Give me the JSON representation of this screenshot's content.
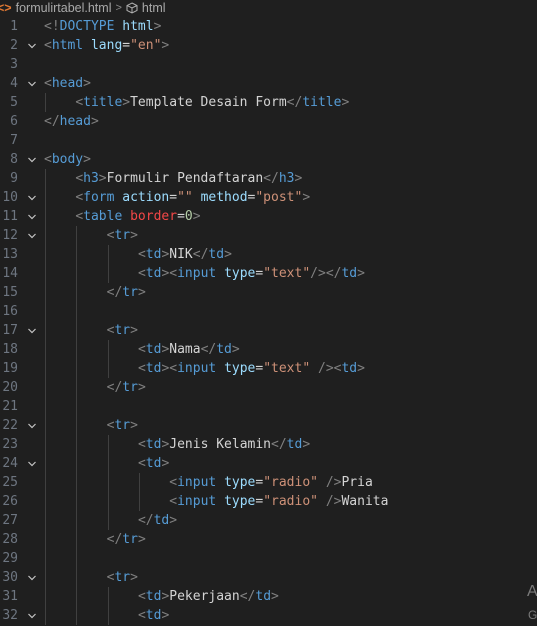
{
  "breadcrumb": {
    "file_icon": "html-file-icon",
    "file": "formulirtabel.html",
    "separator": ">",
    "symbol_icon": "cube-icon",
    "symbol": "html"
  },
  "corner": {
    "a": "A",
    "g": "G"
  },
  "lines": [
    {
      "n": "1",
      "fold": false,
      "indent": 0,
      "tokens": [
        [
          "p",
          "<!"
        ],
        [
          "t",
          "DOCTYPE"
        ],
        [
          "x",
          " "
        ],
        [
          "a",
          "html"
        ],
        [
          "p",
          ">"
        ]
      ]
    },
    {
      "n": "2",
      "fold": true,
      "indent": 0,
      "tokens": [
        [
          "p",
          "<"
        ],
        [
          "t",
          "html"
        ],
        [
          "x",
          " "
        ],
        [
          "a",
          "lang"
        ],
        [
          "e",
          "="
        ],
        [
          "s",
          "\"en\""
        ],
        [
          "p",
          ">"
        ]
      ]
    },
    {
      "n": "3",
      "fold": false,
      "indent": 0,
      "tokens": []
    },
    {
      "n": "4",
      "fold": true,
      "indent": 0,
      "tokens": [
        [
          "p",
          "<"
        ],
        [
          "t",
          "head"
        ],
        [
          "p",
          ">"
        ]
      ]
    },
    {
      "n": "5",
      "fold": false,
      "indent": 1,
      "tokens": [
        [
          "p",
          "<"
        ],
        [
          "t",
          "title"
        ],
        [
          "p",
          ">"
        ],
        [
          "x",
          "Template Desain Form"
        ],
        [
          "p",
          "</"
        ],
        [
          "t",
          "title"
        ],
        [
          "p",
          ">"
        ]
      ]
    },
    {
      "n": "6",
      "fold": false,
      "indent": 0,
      "tokens": [
        [
          "p",
          "</"
        ],
        [
          "t",
          "head"
        ],
        [
          "p",
          ">"
        ]
      ]
    },
    {
      "n": "7",
      "fold": false,
      "indent": 0,
      "tokens": []
    },
    {
      "n": "8",
      "fold": true,
      "indent": 0,
      "tokens": [
        [
          "p",
          "<"
        ],
        [
          "t",
          "body"
        ],
        [
          "p",
          ">"
        ]
      ]
    },
    {
      "n": "9",
      "fold": false,
      "indent": 1,
      "tokens": [
        [
          "p",
          "<"
        ],
        [
          "t",
          "h3"
        ],
        [
          "p",
          ">"
        ],
        [
          "x",
          "Formulir Pendaftaran"
        ],
        [
          "p",
          "</"
        ],
        [
          "t",
          "h3"
        ],
        [
          "p",
          ">"
        ]
      ]
    },
    {
      "n": "10",
      "fold": true,
      "indent": 1,
      "tokens": [
        [
          "p",
          "<"
        ],
        [
          "t",
          "form"
        ],
        [
          "x",
          " "
        ],
        [
          "a",
          "action"
        ],
        [
          "e",
          "="
        ],
        [
          "s",
          "\"\""
        ],
        [
          "x",
          " "
        ],
        [
          "a",
          "method"
        ],
        [
          "e",
          "="
        ],
        [
          "s",
          "\"post\""
        ],
        [
          "p",
          ">"
        ]
      ]
    },
    {
      "n": "11",
      "fold": true,
      "indent": 1,
      "tokens": [
        [
          "p",
          "<"
        ],
        [
          "t",
          "table"
        ],
        [
          "x",
          " "
        ],
        [
          "r",
          "border"
        ],
        [
          "e",
          "="
        ],
        [
          "m",
          "0"
        ],
        [
          "p",
          ">"
        ]
      ]
    },
    {
      "n": "12",
      "fold": true,
      "indent": 2,
      "tokens": [
        [
          "p",
          "<"
        ],
        [
          "t",
          "tr"
        ],
        [
          "p",
          ">"
        ]
      ]
    },
    {
      "n": "13",
      "fold": false,
      "indent": 3,
      "tokens": [
        [
          "p",
          "<"
        ],
        [
          "t",
          "td"
        ],
        [
          "p",
          ">"
        ],
        [
          "x",
          "NIK"
        ],
        [
          "p",
          "</"
        ],
        [
          "t",
          "td"
        ],
        [
          "p",
          ">"
        ]
      ]
    },
    {
      "n": "14",
      "fold": false,
      "indent": 3,
      "tokens": [
        [
          "p",
          "<"
        ],
        [
          "t",
          "td"
        ],
        [
          "p",
          "><"
        ],
        [
          "t",
          "input"
        ],
        [
          "x",
          " "
        ],
        [
          "a",
          "type"
        ],
        [
          "e",
          "="
        ],
        [
          "s",
          "\"text\""
        ],
        [
          "p",
          "/></"
        ],
        [
          "t",
          "td"
        ],
        [
          "p",
          ">"
        ]
      ]
    },
    {
      "n": "15",
      "fold": false,
      "indent": 2,
      "tokens": [
        [
          "p",
          "</"
        ],
        [
          "t",
          "tr"
        ],
        [
          "p",
          ">"
        ]
      ]
    },
    {
      "n": "16",
      "fold": false,
      "indent": 2,
      "tokens": []
    },
    {
      "n": "17",
      "fold": true,
      "indent": 2,
      "tokens": [
        [
          "p",
          "<"
        ],
        [
          "t",
          "tr"
        ],
        [
          "p",
          ">"
        ]
      ]
    },
    {
      "n": "18",
      "fold": false,
      "indent": 3,
      "tokens": [
        [
          "p",
          "<"
        ],
        [
          "t",
          "td"
        ],
        [
          "p",
          ">"
        ],
        [
          "x",
          "Nama"
        ],
        [
          "p",
          "</"
        ],
        [
          "t",
          "td"
        ],
        [
          "p",
          ">"
        ]
      ]
    },
    {
      "n": "19",
      "fold": false,
      "indent": 3,
      "tokens": [
        [
          "p",
          "<"
        ],
        [
          "t",
          "td"
        ],
        [
          "p",
          "><"
        ],
        [
          "t",
          "input"
        ],
        [
          "x",
          " "
        ],
        [
          "a",
          "type"
        ],
        [
          "e",
          "="
        ],
        [
          "s",
          "\"text\""
        ],
        [
          "x",
          " "
        ],
        [
          "p",
          "/><"
        ],
        [
          "t",
          "td"
        ],
        [
          "p",
          ">"
        ]
      ]
    },
    {
      "n": "20",
      "fold": false,
      "indent": 2,
      "tokens": [
        [
          "p",
          "</"
        ],
        [
          "t",
          "tr"
        ],
        [
          "p",
          ">"
        ]
      ]
    },
    {
      "n": "21",
      "fold": false,
      "indent": 2,
      "tokens": []
    },
    {
      "n": "22",
      "fold": true,
      "indent": 2,
      "tokens": [
        [
          "p",
          "<"
        ],
        [
          "t",
          "tr"
        ],
        [
          "p",
          ">"
        ]
      ]
    },
    {
      "n": "23",
      "fold": false,
      "indent": 3,
      "tokens": [
        [
          "p",
          "<"
        ],
        [
          "t",
          "td"
        ],
        [
          "p",
          ">"
        ],
        [
          "x",
          "Jenis Kelamin"
        ],
        [
          "p",
          "</"
        ],
        [
          "t",
          "td"
        ],
        [
          "p",
          ">"
        ]
      ]
    },
    {
      "n": "24",
      "fold": true,
      "indent": 3,
      "tokens": [
        [
          "p",
          "<"
        ],
        [
          "t",
          "td"
        ],
        [
          "p",
          ">"
        ]
      ]
    },
    {
      "n": "25",
      "fold": false,
      "indent": 4,
      "tokens": [
        [
          "p",
          "<"
        ],
        [
          "t",
          "input"
        ],
        [
          "x",
          " "
        ],
        [
          "a",
          "type"
        ],
        [
          "e",
          "="
        ],
        [
          "s",
          "\"radio\""
        ],
        [
          "x",
          " "
        ],
        [
          "p",
          "/>"
        ],
        [
          "x",
          "Pria"
        ]
      ]
    },
    {
      "n": "26",
      "fold": false,
      "indent": 4,
      "tokens": [
        [
          "p",
          "<"
        ],
        [
          "t",
          "input"
        ],
        [
          "x",
          " "
        ],
        [
          "a",
          "type"
        ],
        [
          "e",
          "="
        ],
        [
          "s",
          "\"radio\""
        ],
        [
          "x",
          " "
        ],
        [
          "p",
          "/>"
        ],
        [
          "x",
          "Wanita"
        ]
      ]
    },
    {
      "n": "27",
      "fold": false,
      "indent": 3,
      "tokens": [
        [
          "p",
          "</"
        ],
        [
          "t",
          "td"
        ],
        [
          "p",
          ">"
        ]
      ]
    },
    {
      "n": "28",
      "fold": false,
      "indent": 2,
      "tokens": [
        [
          "p",
          "</"
        ],
        [
          "t",
          "tr"
        ],
        [
          "p",
          ">"
        ]
      ]
    },
    {
      "n": "29",
      "fold": false,
      "indent": 2,
      "tokens": []
    },
    {
      "n": "30",
      "fold": true,
      "indent": 2,
      "tokens": [
        [
          "p",
          "<"
        ],
        [
          "t",
          "tr"
        ],
        [
          "p",
          ">"
        ]
      ]
    },
    {
      "n": "31",
      "fold": false,
      "indent": 3,
      "tokens": [
        [
          "p",
          "<"
        ],
        [
          "t",
          "td"
        ],
        [
          "p",
          ">"
        ],
        [
          "x",
          "Pekerjaan"
        ],
        [
          "p",
          "</"
        ],
        [
          "t",
          "td"
        ],
        [
          "p",
          ">"
        ]
      ]
    },
    {
      "n": "32",
      "fold": true,
      "indent": 3,
      "tokens": [
        [
          "p",
          "<"
        ],
        [
          "t",
          "td"
        ],
        [
          "p",
          ">"
        ]
      ]
    }
  ]
}
